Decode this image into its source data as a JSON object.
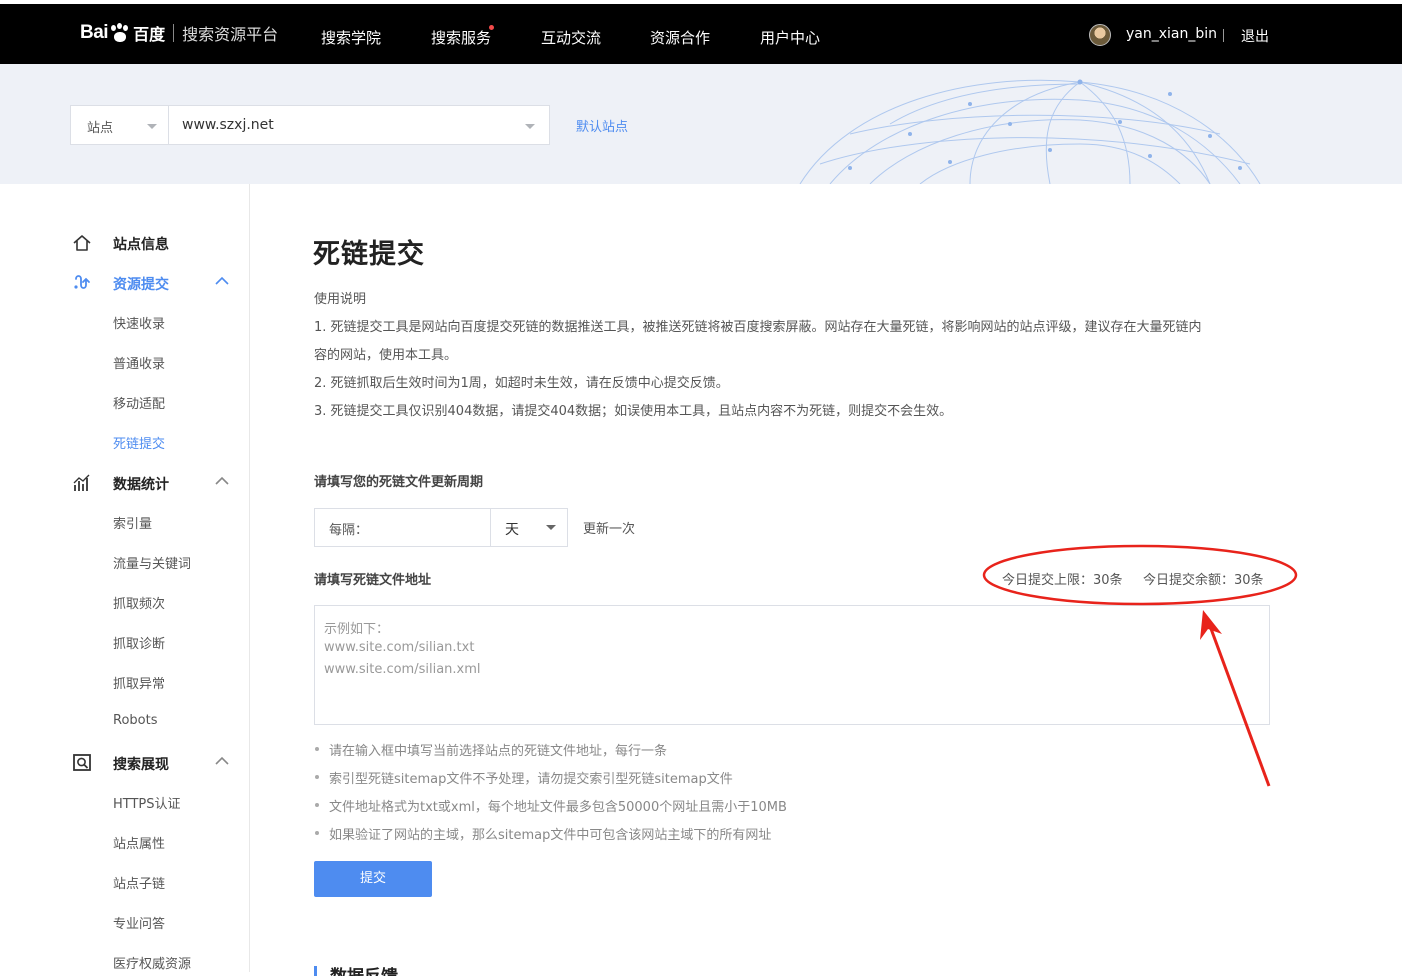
{
  "header": {
    "logo_bai": "Bai",
    "logo_cn": "百度",
    "platform": "搜索资源平台",
    "nav": [
      "搜索学院",
      "搜索服务",
      "互动交流",
      "资源合作",
      "用户中心"
    ],
    "username": "yan_xian_bin",
    "logout": "退出"
  },
  "site_bar": {
    "type_label": "站点",
    "site_value": "www.szxj.net",
    "default_site": "默认站点"
  },
  "sidebar": {
    "groups": [
      {
        "label": "站点信息",
        "icon": "home-icon",
        "expanded": false,
        "items": []
      },
      {
        "label": "资源提交",
        "icon": "resource-submit-icon",
        "expanded": true,
        "active": true,
        "items": [
          "快速收录",
          "普通收录",
          "移动适配",
          "死链提交"
        ],
        "active_item": "死链提交"
      },
      {
        "label": "数据统计",
        "icon": "statistics-icon",
        "expanded": true,
        "items": [
          "索引量",
          "流量与关键词",
          "抓取频次",
          "抓取诊断",
          "抓取异常",
          "Robots"
        ]
      },
      {
        "label": "搜索展现",
        "icon": "search-display-icon",
        "expanded": true,
        "items": [
          "HTTPS认证",
          "站点属性",
          "站点子链",
          "专业问答",
          "医疗权威资源"
        ]
      }
    ]
  },
  "main": {
    "title": "死链提交",
    "usage_heading": "使用说明",
    "usage_lines": [
      "1. 死链提交工具是网站向百度提交死链的数据推送工具，被推送死链将被百度搜索屏蔽。网站存在大量死链，将影响网站的站点评级，建议存在大量死链内",
      "容的网站，使用本工具。",
      "2. 死链抓取后生效时间为1周，如超时未生效，请在反馈中心提交反馈。",
      "3. 死链提交工具仅识别404数据，请提交404数据；如误使用本工具，且站点内容不为死链，则提交不会生效。"
    ],
    "period_label": "请填写您的死链文件更新周期",
    "interval_prefix": "每隔：",
    "interval_unit": "天",
    "interval_suffix": "更新一次",
    "address_label": "请填写死链文件地址",
    "daily_limit": "今日提交上限：30条",
    "daily_remaining": "今日提交余额：30条",
    "placeholder_lines": [
      "示例如下：",
      "www.site.com/silian.txt",
      "www.site.com/silian.xml"
    ],
    "tips": [
      "请在输入框中填写当前选择站点的死链文件地址，每行一条",
      "索引型死链sitemap文件不予处理，请勿提交索引型死链sitemap文件",
      "文件地址格式为txt或xml，每个地址文件最多包含50000个网址且需小于10MB",
      "如果验证了网站的主域，那么sitemap文件中可包含该网站主域下的所有网址"
    ],
    "submit": "提交",
    "next_section": "数据反馈"
  },
  "colors": {
    "accent": "#4e8cf0",
    "topbar": "#000000",
    "annotation": "#e8231b"
  }
}
